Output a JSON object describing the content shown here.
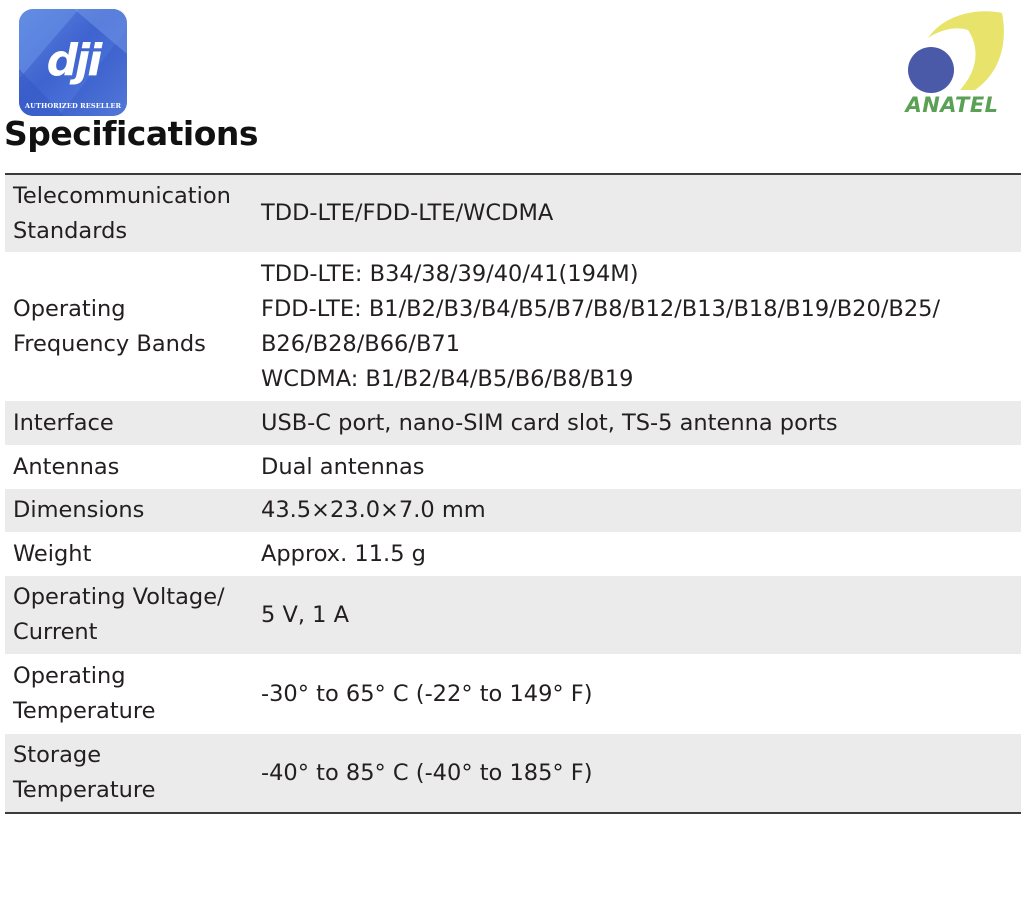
{
  "logos": {
    "dji": {
      "wordmark": "dji",
      "subtitle": "AUTHORIZED RESELLER",
      "color": "#4a6fd6"
    },
    "anatel": {
      "text": "ANATEL",
      "circle_color": "#4a5aa8",
      "arc_color": "#e8e36a",
      "text_color": "#5aa055"
    }
  },
  "page": {
    "title": "Specifications"
  },
  "specs": [
    {
      "label_lines": [
        "Telecommunication",
        "Standards"
      ],
      "value_lines": [
        "TDD-LTE/FDD-LTE/WCDMA"
      ]
    },
    {
      "label_lines": [
        "Operating",
        "Frequency Bands"
      ],
      "value_lines": [
        "TDD-LTE: B34/38/39/40/41(194M)",
        "FDD-LTE: B1/B2/B3/B4/B5/B7/B8/B12/B13/B18/B19/B20/B25/",
        "B26/B28/B66/B71",
        "WCDMA: B1/B2/B4/B5/B6/B8/B19"
      ]
    },
    {
      "label_lines": [
        "Interface"
      ],
      "value_lines": [
        "USB-C port, nano-SIM card slot, TS-5 antenna ports"
      ]
    },
    {
      "label_lines": [
        "Antennas"
      ],
      "value_lines": [
        "Dual antennas"
      ]
    },
    {
      "label_lines": [
        "Dimensions"
      ],
      "value_lines": [
        "43.5×23.0×7.0 mm"
      ]
    },
    {
      "label_lines": [
        "Weight"
      ],
      "value_lines": [
        "Approx. 11.5 g"
      ]
    },
    {
      "label_lines": [
        "Operating Voltage/",
        "Current"
      ],
      "value_lines": [
        "5 V, 1 A"
      ]
    },
    {
      "label_lines": [
        "Operating",
        "Temperature"
      ],
      "value_lines": [
        "-30° to 65° C (-22° to 149° F)"
      ]
    },
    {
      "label_lines": [
        "Storage",
        "Temperature"
      ],
      "value_lines": [
        "-40° to 85° C (-40° to 185° F)"
      ]
    }
  ]
}
